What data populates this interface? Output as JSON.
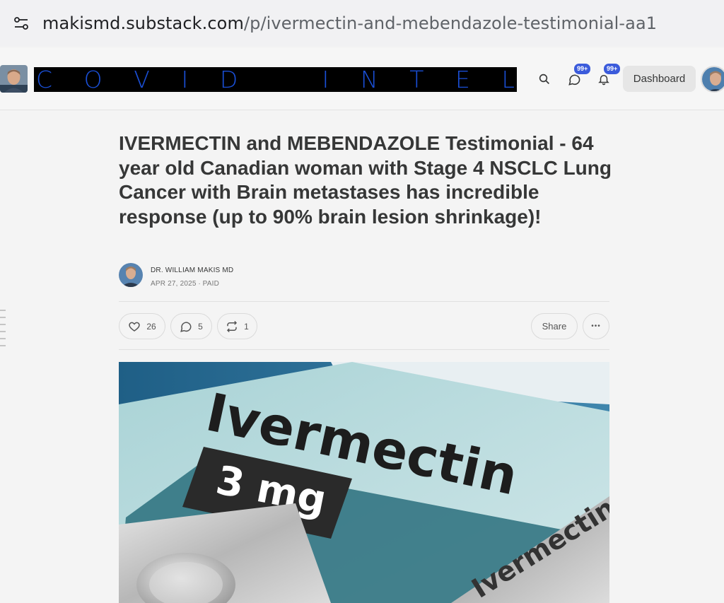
{
  "browser": {
    "url_host": "makismd.substack.com",
    "url_path": "/p/ivermectin-and-mebendazole-testimonial-aa1",
    "icons": {
      "site_info": "tune-icon"
    }
  },
  "header": {
    "banner_letters": [
      "C",
      "O",
      "V",
      "I",
      "D",
      "",
      "I",
      "N",
      "T",
      "E",
      "L"
    ],
    "icons": {
      "search": "search-icon",
      "chat": "chat-icon",
      "bell": "bell-icon"
    },
    "chat_badge": "99+",
    "bell_badge": "99+",
    "dashboard_label": "Dashboard"
  },
  "article": {
    "title": "IVERMECTIN and MEBENDAZOLE Testimonial - 64 year old Canadian woman with Stage 4 NSCLC Lung Cancer with Brain metastases has incredible response (up to 90% brain lesion shrinkage)!",
    "author": "DR. WILLIAM MAKIS MD",
    "meta": "APR 27, 2025 ∙ PAID",
    "likes": "26",
    "comments": "5",
    "restacks": "1",
    "share_label": "Share",
    "more_label": "•••",
    "hero": {
      "word": "Ivermectin",
      "dose": "3 mg",
      "blister_word": "Ivermectin"
    }
  },
  "colors": {
    "banner_bg": "#000000",
    "banner_letters": "#1a4fd6",
    "badge": "#3b5bdb",
    "page_bg": "#f4f4f4"
  }
}
